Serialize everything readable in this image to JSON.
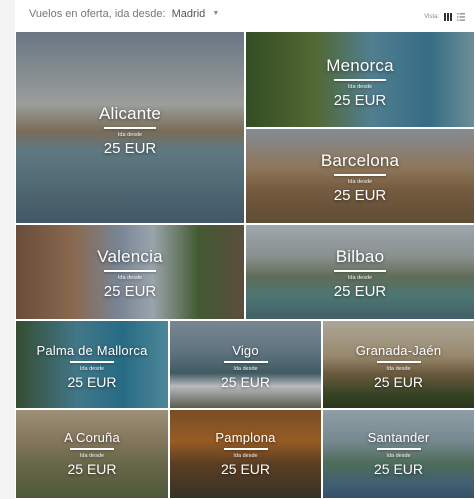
{
  "header": {
    "origin_prefix": "Vuelos en oferta, ida desde:",
    "origin_city": "Madrid",
    "view_label": "Vista:"
  },
  "destinations": [
    {
      "city": "Alicante",
      "from_label": "Ida desde",
      "price": "25 EUR"
    },
    {
      "city": "Menorca",
      "from_label": "Ida desde",
      "price": "25 EUR"
    },
    {
      "city": "Barcelona",
      "from_label": "Ida desde",
      "price": "25 EUR"
    },
    {
      "city": "Valencia",
      "from_label": "Ida desde",
      "price": "25 EUR"
    },
    {
      "city": "Bilbao",
      "from_label": "Ida desde",
      "price": "25 EUR"
    },
    {
      "city": "Palma de Mallorca",
      "from_label": "Ida desde",
      "price": "25 EUR"
    },
    {
      "city": "Vigo",
      "from_label": "Ida desde",
      "price": "25 EUR"
    },
    {
      "city": "Granada-Jaén",
      "from_label": "Ida desde",
      "price": "25 EUR"
    },
    {
      "city": "A Coruña",
      "from_label": "Ida desde",
      "price": "25 EUR"
    },
    {
      "city": "Pamplona",
      "from_label": "Ida desde",
      "price": "25 EUR"
    },
    {
      "city": "Santander",
      "from_label": "Ida desde",
      "price": "25 EUR"
    }
  ]
}
